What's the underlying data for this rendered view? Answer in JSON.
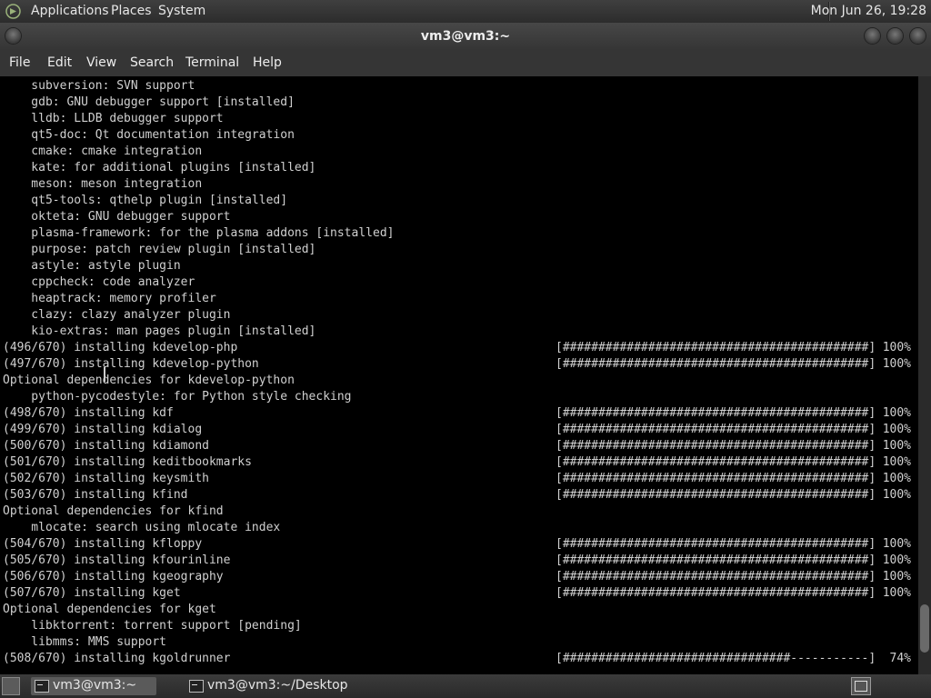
{
  "top_panel": {
    "menus": [
      "Applications",
      "Places",
      "System"
    ],
    "clock": "Mon Jun 26, 19:28"
  },
  "window": {
    "title": "vm3@vm3:~"
  },
  "menubar": {
    "items": [
      "File",
      "Edit",
      "View",
      "Search",
      "Terminal",
      "Help"
    ]
  },
  "terminal": {
    "lines": [
      {
        "text": "    subversion: SVN support"
      },
      {
        "text": "    gdb: GNU debugger support [installed]"
      },
      {
        "text": "    lldb: LLDB debugger support"
      },
      {
        "text": "    qt5-doc: Qt documentation integration"
      },
      {
        "text": "    cmake: cmake integration"
      },
      {
        "text": "    kate: for additional plugins [installed]"
      },
      {
        "text": "    meson: meson integration"
      },
      {
        "text": "    qt5-tools: qthelp plugin [installed]"
      },
      {
        "text": "    okteta: GNU debugger support"
      },
      {
        "text": "    plasma-framework: for the plasma addons [installed]"
      },
      {
        "text": "    purpose: patch review plugin [installed]"
      },
      {
        "text": "    astyle: astyle plugin"
      },
      {
        "text": "    cppcheck: code analyzer"
      },
      {
        "text": "    heaptrack: memory profiler"
      },
      {
        "text": "    clazy: clazy analyzer plugin"
      },
      {
        "text": "    kio-extras: man pages plugin [installed]"
      },
      {
        "text": "(496/670) installing kdevelop-php",
        "bar": "[###########################################]",
        "pct": "100%"
      },
      {
        "text": "(497/670) installing kdevelop-python",
        "bar": "[###########################################]",
        "pct": "100%"
      },
      {
        "text": "Optional dependencies for kdevelop-python"
      },
      {
        "text": "    python-pycodestyle: for Python style checking"
      },
      {
        "text": "(498/670) installing kdf",
        "bar": "[###########################################]",
        "pct": "100%"
      },
      {
        "text": "(499/670) installing kdialog",
        "bar": "[###########################################]",
        "pct": "100%"
      },
      {
        "text": "(500/670) installing kdiamond",
        "bar": "[###########################################]",
        "pct": "100%"
      },
      {
        "text": "(501/670) installing keditbookmarks",
        "bar": "[###########################################]",
        "pct": "100%"
      },
      {
        "text": "(502/670) installing keysmith",
        "bar": "[###########################################]",
        "pct": "100%"
      },
      {
        "text": "(503/670) installing kfind",
        "bar": "[###########################################]",
        "pct": "100%"
      },
      {
        "text": "Optional dependencies for kfind"
      },
      {
        "text": "    mlocate: search using mlocate index"
      },
      {
        "text": "(504/670) installing kfloppy",
        "bar": "[###########################################]",
        "pct": "100%"
      },
      {
        "text": "(505/670) installing kfourinline",
        "bar": "[###########################################]",
        "pct": "100%"
      },
      {
        "text": "(506/670) installing kgeography",
        "bar": "[###########################################]",
        "pct": "100%"
      },
      {
        "text": "(507/670) installing kget",
        "bar": "[###########################################]",
        "pct": "100%"
      },
      {
        "text": "Optional dependencies for kget"
      },
      {
        "text": "    libktorrent: torrent support [pending]"
      },
      {
        "text": "    libmms: MMS support"
      },
      {
        "text": "(508/670) installing kgoldrunner",
        "bar": "[################################-----------]",
        "pct": " 74%"
      }
    ],
    "scroll_position": 0.96,
    "scroll_visible_fraction": 0.08
  },
  "taskbar": {
    "tasks": [
      {
        "label": "vm3@vm3:~",
        "active": true
      },
      {
        "label": "vm3@vm3:~/Desktop",
        "active": false
      }
    ]
  },
  "colors": {
    "terminal_bg": "#000000",
    "terminal_fg": "#d0d0d0",
    "panel_bg": "#353535"
  }
}
